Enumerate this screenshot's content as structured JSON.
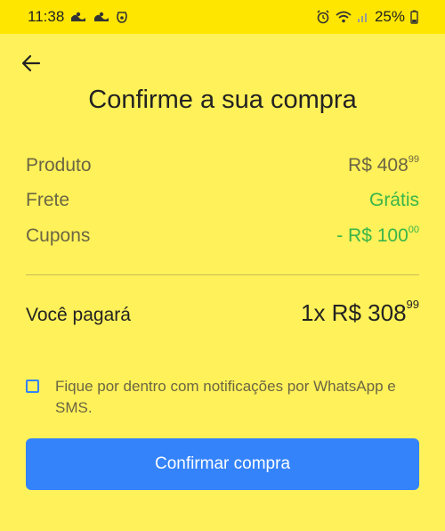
{
  "status_bar": {
    "time": "11:38",
    "battery": "25%",
    "left_icons": [
      "notification-icon",
      "notification-icon",
      "notification-icon"
    ],
    "right_icons": [
      "alarm-icon",
      "wifi-icon",
      "signal-icon",
      "battery-icon"
    ]
  },
  "header": {
    "title": "Confirme a sua compra"
  },
  "summary": {
    "items": [
      {
        "label": "Produto",
        "value": "R$ 408",
        "cents": "99",
        "color": "#6b6644"
      },
      {
        "label": "Frete",
        "value": "Grátis",
        "cents": "",
        "color": "#39b54a"
      },
      {
        "label": "Cupons",
        "value": "- R$ 100",
        "cents": "00",
        "color": "#39b54a"
      }
    ]
  },
  "total": {
    "label": "Você pagará",
    "value": "1x R$ 308",
    "cents": "99"
  },
  "notifications": {
    "label": "Fique por dentro com notificações por WhatsApp e SMS.",
    "checked": false
  },
  "actions": {
    "confirm_label": "Confirmar compra"
  },
  "colors": {
    "background": "#fff159",
    "status_bar": "#ffe600",
    "accent": "#3483fa",
    "discount": "#39b54a"
  }
}
